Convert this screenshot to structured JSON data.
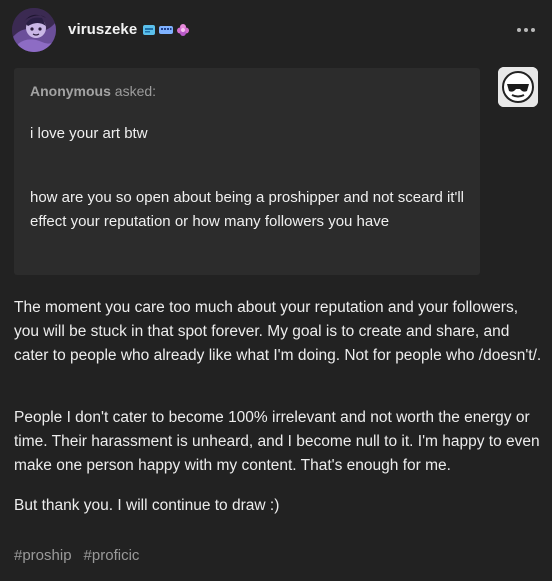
{
  "header": {
    "username": "viruszeke",
    "badges": [
      "blue-badge-icon",
      "keyboard-badge-icon",
      "pink-flower-badge-icon"
    ],
    "more_icon": "more-options-icon"
  },
  "ask": {
    "asker_name": "Anonymous",
    "asked_label": "asked:",
    "line1": "i love your art btw",
    "line2": "how are you so open about being a proshipper and not sceard it'll effect your reputation or how many followers you have",
    "asker_avatar_icon": "sunglasses-face-icon"
  },
  "answer": {
    "p1": "The moment you care too much about your reputation and your followers, you will be stuck in that spot forever. My goal is to create and share, and cater to people who already like what I'm doing. Not for people who /doesn't/.",
    "p2": "People I don't cater to become 100% irrelevant and not worth the energy or time. Their harassment is unheard, and I become null to it. I'm happy to even make one person happy with my content. That's enough for me.",
    "p3": "But thank you. I will continue to draw :)"
  },
  "tags": [
    "#proship",
    "#proficic"
  ],
  "colors": {
    "background": "#222222",
    "ask_box": "#2c2c2c",
    "text": "#ededed",
    "muted": "#9a9a9a"
  }
}
